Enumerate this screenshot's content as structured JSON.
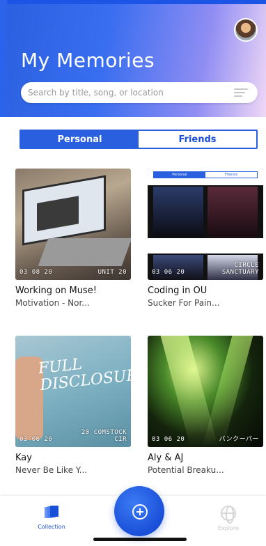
{
  "header": {
    "title": "My Memories",
    "search_placeholder": "Search by title, song, or location"
  },
  "tabs": [
    {
      "label": "Personal",
      "active": true
    },
    {
      "label": "Friends",
      "active": false
    }
  ],
  "memories": [
    {
      "title": "Working on Muse!",
      "subtitle": "Motivation - Nor...",
      "date": "03 08 20",
      "location": "UNIT 20"
    },
    {
      "title": "Coding in OU",
      "subtitle": "Sucker For Pain...",
      "date": "03 06 20",
      "location": "CIRCLE\nSANCTUARY"
    },
    {
      "title": "Kay",
      "subtitle": "Never Be Like Y...",
      "date": "03 06 20",
      "location": "20 COMSTOCK\nCIR"
    },
    {
      "title": "Aly & AJ",
      "subtitle": "Potential Breaku...",
      "date": "03 06 20",
      "location": "バンクーバー"
    }
  ],
  "nested_preview": {
    "tabs": [
      "Personal",
      "Friends"
    ]
  },
  "thumbnail_text": {
    "kay_cover": "FULL\nDISCLOSURE"
  },
  "bottom_nav": {
    "collection_label": "Collection",
    "explore_label": "Explore"
  },
  "colors": {
    "accent": "#2a5fe0",
    "accent_dark": "#1a4fd8"
  }
}
